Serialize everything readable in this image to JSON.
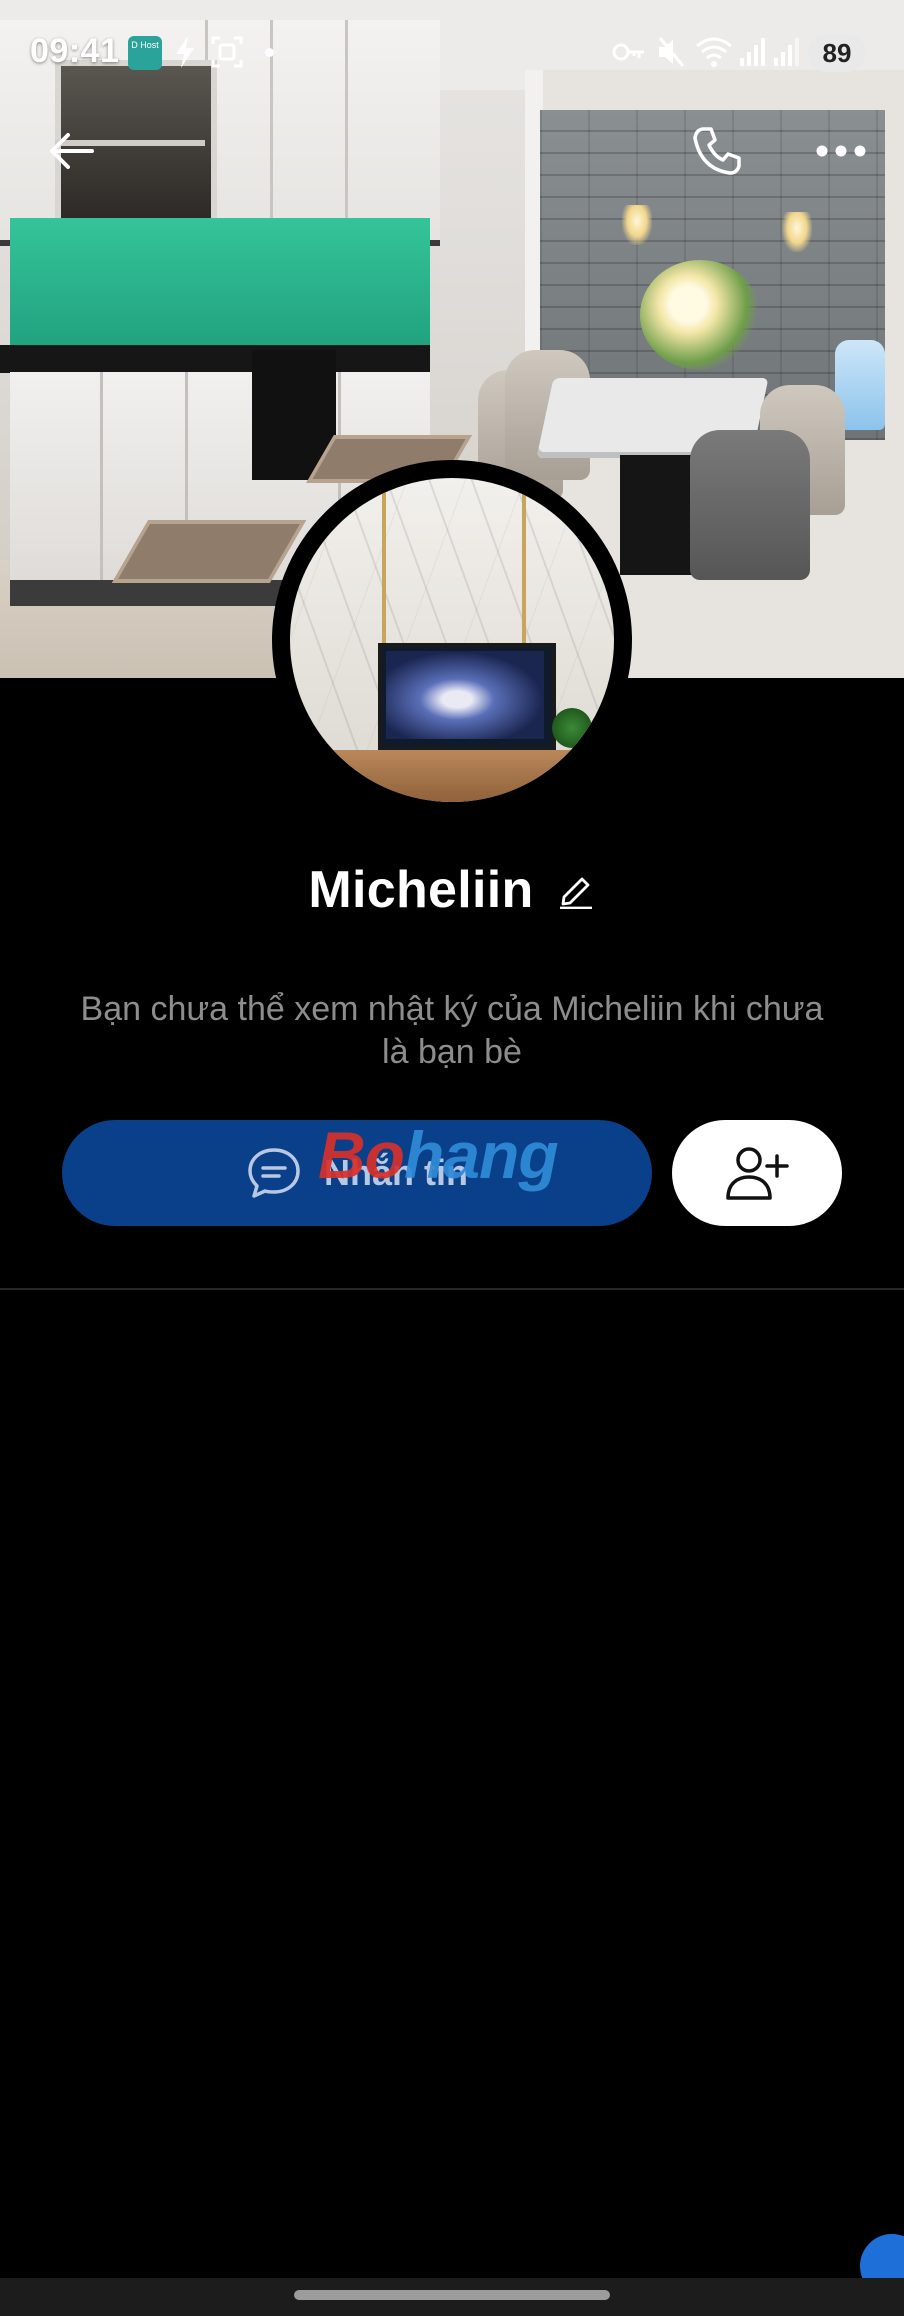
{
  "status_bar": {
    "time": "09:41",
    "app_icon_label": "D Host",
    "battery": "89"
  },
  "nav": {
    "back_icon": "arrow-left-icon",
    "call_icon": "phone-icon",
    "more_icon": "more-horizontal-icon"
  },
  "profile": {
    "name": "Micheliin",
    "notice": "Bạn chưa thể xem nhật ký của Micheliin khi chưa là bạn bè"
  },
  "actions": {
    "message_label": "Nhắn tin",
    "message_icon": "chat-bubble-icon",
    "add_friend_icon": "user-plus-icon"
  },
  "watermark": {
    "part1": "Bo",
    "part2": "hang"
  },
  "colors": {
    "background": "#000000",
    "message_button": "#0a3f8a",
    "add_button": "#ffffff",
    "notice_text": "#8d8d8d"
  }
}
